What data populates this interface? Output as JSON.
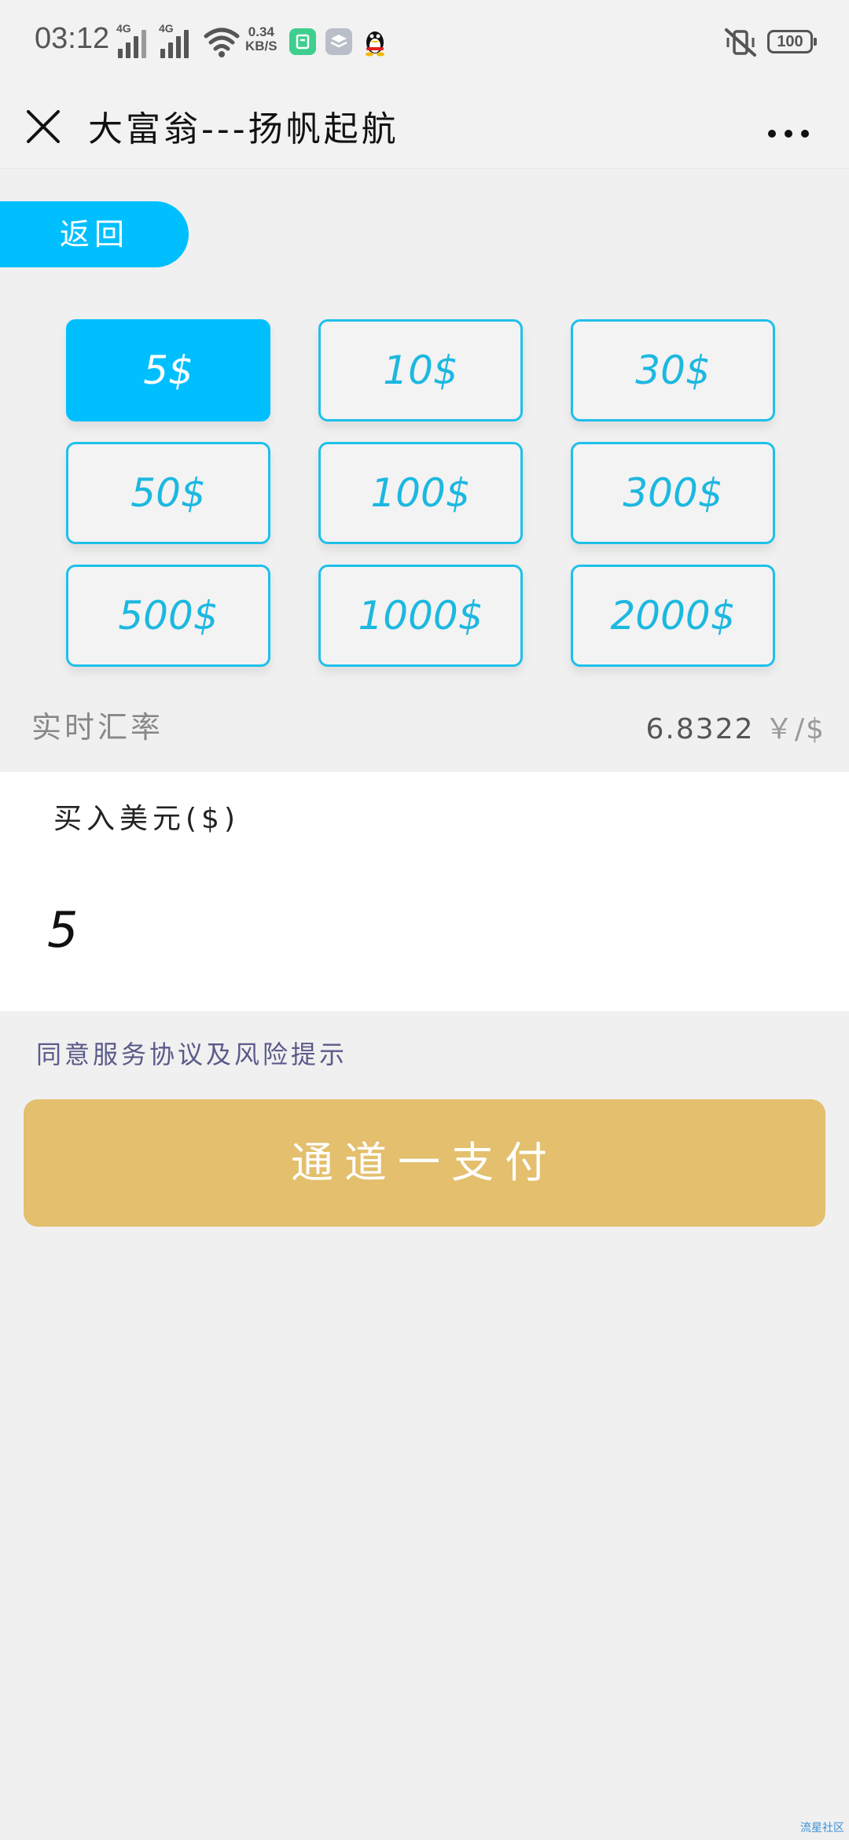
{
  "status_bar": {
    "time": "03:12",
    "signal1_label": "4G",
    "signal2_label": "4G",
    "speed_value": "0.34",
    "speed_unit": "KB/S",
    "battery": "100",
    "colors": {
      "app1": "#3ecf8e",
      "app2": "#b9bec8"
    }
  },
  "title_bar": {
    "close_icon": "close-icon",
    "title": "大富翁---扬帆起航",
    "more_icon": "more-icon"
  },
  "back_button": {
    "label": "返回"
  },
  "amounts": [
    {
      "label": "5$",
      "selected": true
    },
    {
      "label": "10$",
      "selected": false
    },
    {
      "label": "30$",
      "selected": false
    },
    {
      "label": "50$",
      "selected": false
    },
    {
      "label": "100$",
      "selected": false
    },
    {
      "label": "300$",
      "selected": false
    },
    {
      "label": "500$",
      "selected": false
    },
    {
      "label": "1000$",
      "selected": false
    },
    {
      "label": "2000$",
      "selected": false
    }
  ],
  "rate": {
    "label": "实时汇率",
    "value": "6.8322",
    "unit": "￥/$"
  },
  "buy": {
    "label": "买入美元($)",
    "value": "5"
  },
  "agreement": {
    "text": "同意服务协议及风险提示"
  },
  "pay_button": {
    "label": "通道一支付"
  },
  "colors": {
    "accent": "#00bfff",
    "pay": "#e3bf6e",
    "background": "#f0f0f0"
  },
  "watermark": "流星社区"
}
